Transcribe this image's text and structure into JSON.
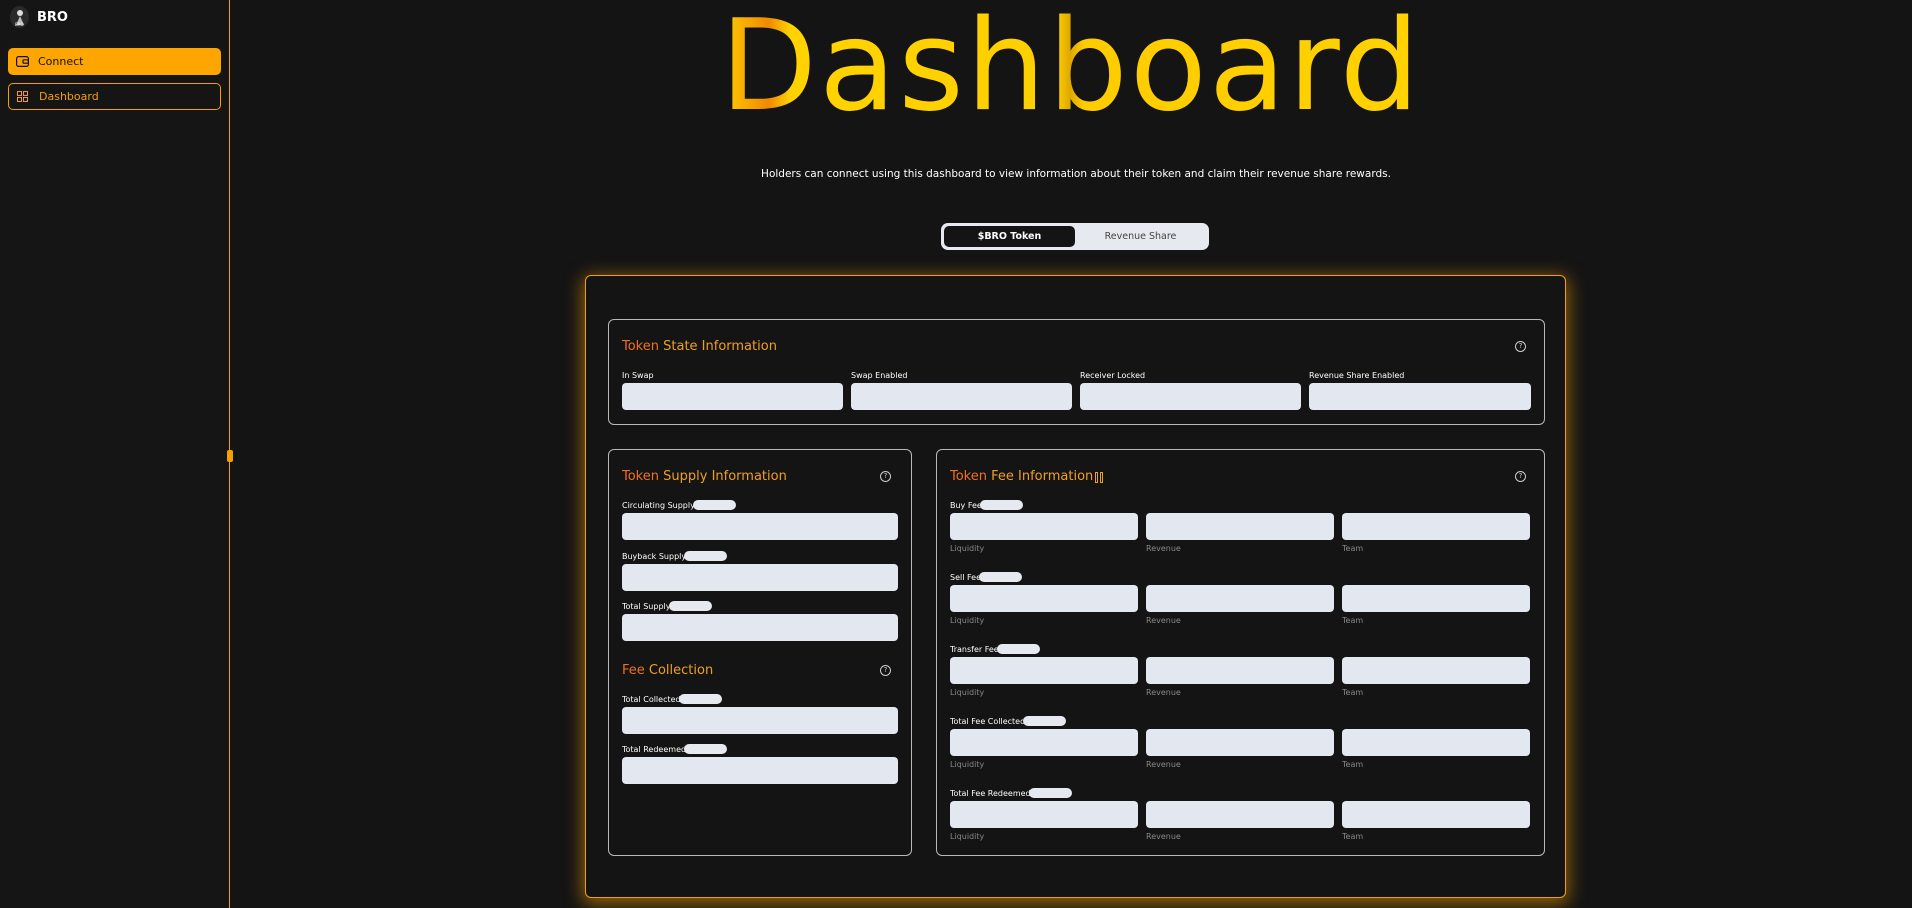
{
  "sidebar": {
    "brand": "BRO",
    "logo_text": "BRO",
    "items": [
      {
        "label": "Connect",
        "icon": "wallet-icon"
      },
      {
        "label": "Dashboard",
        "icon": "grid-icon"
      }
    ]
  },
  "header": {
    "title": "Dashboard",
    "subtitle": "Holders can connect using this dashboard to view information about their token and claim their revenue share rewards."
  },
  "tabs": [
    {
      "label": "$BRO Token",
      "active": true
    },
    {
      "label": "Revenue Share",
      "active": false
    }
  ],
  "state_card": {
    "title_first": "Token",
    "title_rest": " State Information",
    "fields": [
      "In Swap",
      "Swap Enabled",
      "Receiver Locked",
      "Revenue Share Enabled"
    ]
  },
  "supply_card": {
    "title_first": "Token",
    "title_rest": " Supply Information",
    "fields": [
      "Circulating Supply",
      "Buyback Supply",
      "Total Supply"
    ],
    "fee_title_first": "Fee",
    "fee_title_rest": " Collection",
    "fee_fields": [
      "Total Collected",
      "Total Redeemed"
    ]
  },
  "fee_card": {
    "title_first": "Token",
    "title_rest": " Fee Information",
    "rows": [
      "Buy Fee",
      "Sell Fee",
      "Transfer Fee",
      "Total Fee Collected",
      "Total Fee Redeemed"
    ],
    "columns": [
      "Liquidity",
      "Revenue",
      "Team"
    ]
  },
  "colors": {
    "accent": "#ffa500",
    "title": "#ffd200",
    "background": "#141414"
  }
}
